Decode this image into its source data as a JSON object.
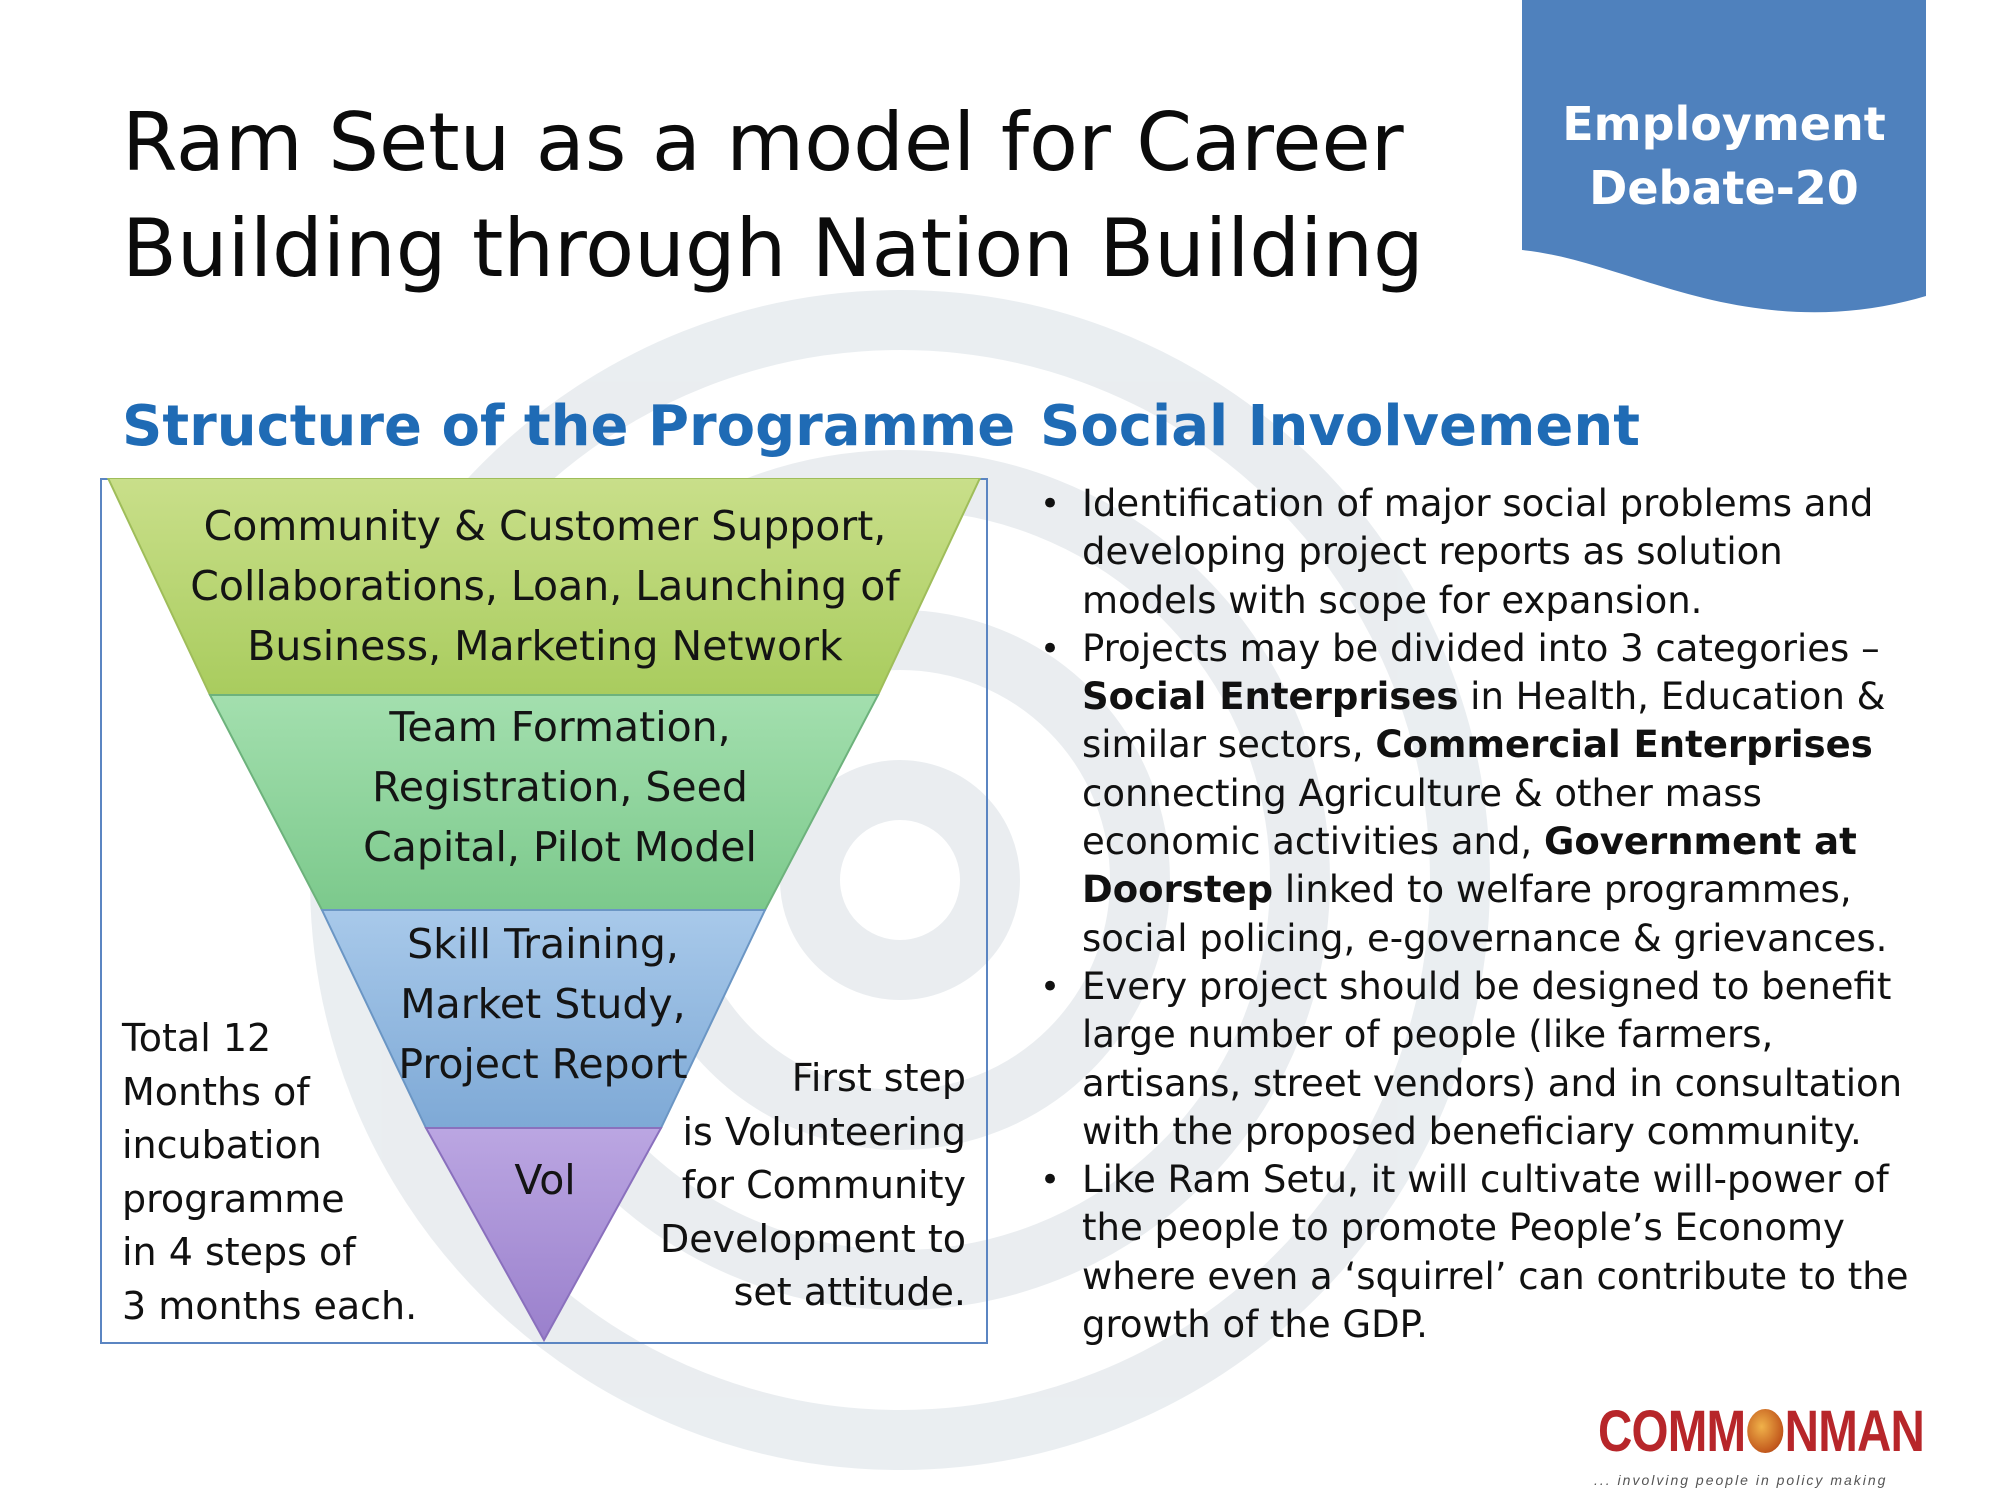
{
  "title": {
    "line1": "Ram Setu as a model for Career",
    "line2": "Building through Nation Building"
  },
  "banner": {
    "line1": "Employment",
    "line2": "Debate-20",
    "color": "#4f81bd"
  },
  "structure": {
    "heading": "Structure of the Programme",
    "layers": [
      {
        "lines": [
          "Community & Customer Support,",
          "Collaborations, Loan, Launching of",
          "Business, Marketing Network"
        ],
        "color": "#b5d36a"
      },
      {
        "lines": [
          "Team Formation,",
          "Registration, Seed",
          "Capital, Pilot Model"
        ],
        "color": "#8fd39a"
      },
      {
        "lines": [
          "Skill Training,",
          "Market Study,",
          "Project Report"
        ],
        "color": "#8fb6de"
      },
      {
        "lines": [
          "Vol"
        ],
        "color": "#a98fd6"
      }
    ],
    "left_note": [
      "Total 12",
      "Months of",
      "incubation",
      "programme",
      "in 4 steps  of",
      "3 months each."
    ],
    "right_note": [
      "First step",
      "is Volunteering",
      "for Community",
      "Development to",
      "set  attitude."
    ]
  },
  "social": {
    "heading": "Social Involvement",
    "bullets": [
      {
        "lines": [
          [
            {
              "t": "Identification of major social problems and"
            }
          ],
          [
            {
              "t": "developing project reports as solution"
            }
          ],
          [
            {
              "t": "models with scope for expansion."
            }
          ]
        ]
      },
      {
        "lines": [
          [
            {
              "t": "Projects may be divided into 3 categories –"
            }
          ],
          [
            {
              "t": "Social Enterprises",
              "b": true
            },
            {
              "t": " in Health, Education &"
            }
          ],
          [
            {
              "t": "similar sectors, "
            },
            {
              "t": "Commercial Enterprises",
              "b": true
            }
          ],
          [
            {
              "t": "connecting Agriculture & other mass"
            }
          ],
          [
            {
              "t": "economic activities and, "
            },
            {
              "t": "Government at",
              "b": true
            }
          ],
          [
            {
              "t": "Doorstep",
              "b": true
            },
            {
              "t": " linked to welfare programmes,"
            }
          ],
          [
            {
              "t": "social policing, e-governance & grievances."
            }
          ]
        ]
      },
      {
        "lines": [
          [
            {
              "t": "Every project should be designed to benefit"
            }
          ],
          [
            {
              "t": "large number of people (like farmers,"
            }
          ],
          [
            {
              "t": "artisans, street vendors) and in consultation"
            }
          ],
          [
            {
              "t": "with the proposed beneficiary community."
            }
          ]
        ]
      },
      {
        "lines": [
          [
            {
              "t": "Like Ram Setu, it will cultivate will-power of"
            }
          ],
          [
            {
              "t": "the people to promote People’s Economy"
            }
          ],
          [
            {
              "t": "where even a ‘squirrel’ can contribute to the"
            }
          ],
          [
            {
              "t": "growth of the GDP."
            }
          ]
        ]
      }
    ]
  },
  "logo": {
    "word_before": "COMM",
    "word_after": "NMAN",
    "tagline": "... involving people in policy making",
    "color": "#b7262a"
  }
}
